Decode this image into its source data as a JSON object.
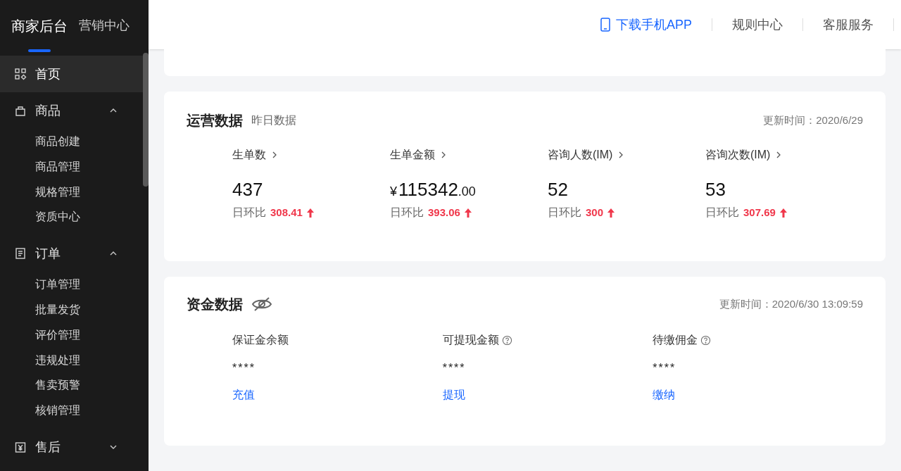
{
  "sidebar": {
    "header_tabs": [
      {
        "label": "商家后台",
        "selected": true
      },
      {
        "label": "营销中心",
        "selected": false
      }
    ],
    "items": [
      {
        "label": "首页",
        "kind": "link",
        "selected": true
      },
      {
        "label": "商品",
        "kind": "group",
        "selected": false,
        "expanded": true,
        "children": [
          {
            "label": "商品创建",
            "selected": false
          },
          {
            "label": "商品管理",
            "selected": false
          },
          {
            "label": "规格管理",
            "selected": false
          },
          {
            "label": "资质中心",
            "selected": false
          }
        ]
      },
      {
        "label": "订单",
        "kind": "group",
        "selected": false,
        "expanded": true,
        "children": [
          {
            "label": "订单管理",
            "selected": false
          },
          {
            "label": "批量发货",
            "selected": false
          },
          {
            "label": "评价管理",
            "selected": false
          },
          {
            "label": "违规处理",
            "selected": false
          },
          {
            "label": "售卖预警",
            "selected": false
          },
          {
            "label": "核销管理",
            "selected": false
          }
        ]
      },
      {
        "label": "售后",
        "kind": "group",
        "selected": false,
        "expanded": false
      }
    ]
  },
  "top_bar": {
    "links": [
      {
        "label": "下载手机APP",
        "highlighted": true
      },
      {
        "label": "规则中心",
        "highlighted": false
      },
      {
        "label": "客服服务",
        "highlighted": false
      }
    ]
  },
  "operations": {
    "title": "运营数据",
    "subtitle": "昨日数据",
    "updated": "更新时间：2020/6/29",
    "metrics": [
      {
        "name": "生单数",
        "value": "437",
        "ratio_label": "日环比",
        "ratio": "308.41"
      },
      {
        "name": "生单金额",
        "currency": "¥",
        "value": "115342",
        "fraction": ".00",
        "ratio_label": "日环比",
        "ratio": "393.06"
      },
      {
        "name": "咨询人数(IM)",
        "value": "52",
        "ratio_label": "日环比",
        "ratio": "300"
      },
      {
        "name": "咨询次数(IM)",
        "value": "53",
        "ratio_label": "日环比",
        "ratio": "307.69"
      }
    ]
  },
  "funds": {
    "title": "资金数据",
    "hidden": true,
    "updated": "更新时间：2020/6/30 13:09:59",
    "items": [
      {
        "label": "保证金余额",
        "help": false,
        "value": "****",
        "action": "充值"
      },
      {
        "label": "可提现金额",
        "help": true,
        "value": "****",
        "action": "提现"
      },
      {
        "label": "待缴佣金",
        "help": true,
        "value": "****",
        "action": "缴纳"
      }
    ]
  }
}
